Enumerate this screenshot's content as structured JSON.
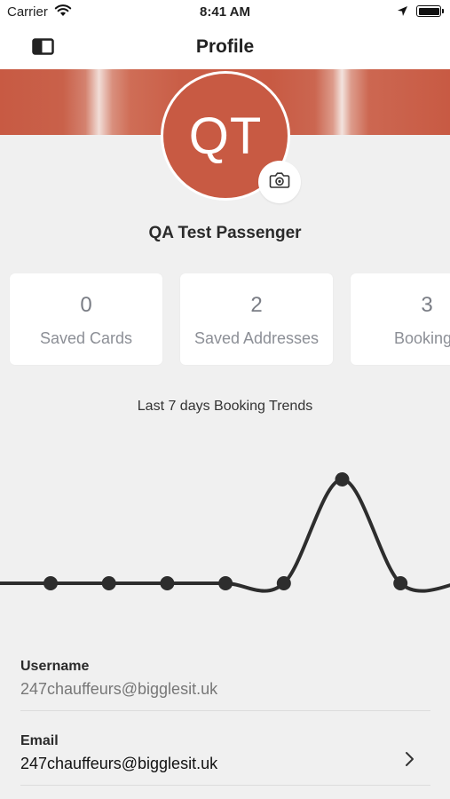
{
  "status_bar": {
    "carrier": "Carrier",
    "time": "8:41 AM",
    "icons": [
      "wifi-icon",
      "location-arrow-icon",
      "battery-icon"
    ]
  },
  "nav": {
    "title": "Profile",
    "menu_icon": "sidebar-toggle-icon"
  },
  "theme": {
    "accent": "#c85a43",
    "background": "#f0f0f0",
    "card": "#ffffff"
  },
  "profile": {
    "initials": "QT",
    "name": "QA Test Passenger",
    "camera_icon": "camera-icon"
  },
  "stats": [
    {
      "count": "0",
      "label": "Saved Cards"
    },
    {
      "count": "2",
      "label": "Saved Addresses"
    },
    {
      "count": "3",
      "label": "Bookings"
    }
  ],
  "chart_data": {
    "type": "line",
    "title": "Last 7 days Booking Trends",
    "smooth": true,
    "values": [
      0,
      0,
      0,
      0,
      0,
      3,
      0
    ],
    "ylim": [
      0,
      3
    ],
    "grid": false,
    "legend": "none"
  },
  "fields": [
    {
      "label": "Username",
      "value": "247chauffeurs@bigglesit.uk"
    },
    {
      "label": "Email",
      "value": "247chauffeurs@bigglesit.uk"
    }
  ]
}
